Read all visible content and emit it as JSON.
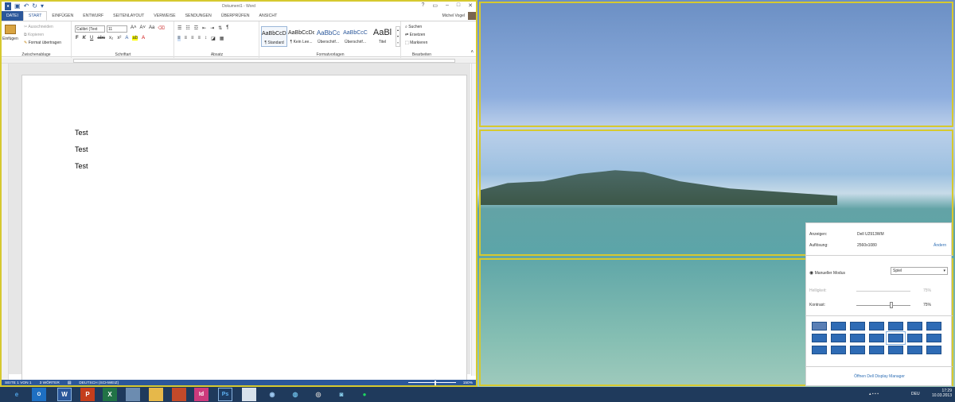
{
  "word": {
    "title": "Dokument1 - Word",
    "user": "Michel Vogel",
    "tabs": [
      "DATEI",
      "START",
      "EINFÜGEN",
      "ENTWURF",
      "SEITENLAYOUT",
      "VERWEISE",
      "SENDUNGEN",
      "ÜBERPRÜFEN",
      "ANSICHT"
    ],
    "clipboard": {
      "paste": "Einfügen",
      "cut": "Ausschneiden",
      "copy": "Kopieren",
      "format_painter": "Format übertragen",
      "label": "Zwischenablage"
    },
    "font": {
      "name": "Calibri (Text",
      "size": "11",
      "label": "Schriftart"
    },
    "paragraph_label": "Absatz",
    "styles": {
      "label": "Formatvorlagen",
      "items": [
        {
          "sample": "AaBbCcDc",
          "name": "¶ Standard"
        },
        {
          "sample": "AaBbCcDc",
          "name": "¶ Kein Lee..."
        },
        {
          "sample": "AaBbCc",
          "name": "Überschrif..."
        },
        {
          "sample": "AaBbCcC",
          "name": "Überschrif..."
        },
        {
          "sample": "AaBl",
          "name": "Titel"
        }
      ]
    },
    "editing": {
      "find": "Suchen",
      "replace": "Ersetzen",
      "select": "Markieren",
      "label": "Bearbeiten"
    },
    "document_lines": [
      "Test",
      "Test",
      "Test"
    ],
    "status": {
      "page": "SEITE 1 VON 1",
      "words": "3 WÖRTER",
      "language": "DEUTSCH (SCHWEIZ)",
      "zoom": "150%"
    }
  },
  "display_manager": {
    "display_label": "Anzeigen:",
    "display_value": "Dell U2913WM",
    "resolution_label": "Auflösung:",
    "resolution_value": "2560x1080",
    "change_link": "Ändern",
    "manual_mode": "Manueller Modus",
    "mode_value": "Spiel",
    "brightness_label": "Helligkeit:",
    "brightness_value": "75%",
    "brightness_level": 0.75,
    "contrast_label": "Kontrast:",
    "contrast_value": "75%",
    "contrast_level": 0.75,
    "open_link": "Öffnen Dell Display Manager"
  },
  "taskbar": {
    "apps": [
      "ie-icon",
      "outlook-icon",
      "word-icon",
      "powerpoint-icon",
      "excel-icon",
      "app-icon",
      "explorer-icon",
      "app-icon",
      "indesign-icon",
      "photoshop-icon",
      "app-icon",
      "app-icon",
      "app-icon",
      "app-icon",
      "app-icon",
      "spotify-icon"
    ],
    "word_letter": "W",
    "ppt_letter": "P",
    "excel_letter": "X",
    "indesign_letter": "Id",
    "ps_letter": "Ps",
    "lang": "DEU",
    "time": "17:29",
    "date": "10.03.2013"
  },
  "colors": {
    "word_blue": "#2b579a",
    "panel_border": "#d6c92f"
  }
}
